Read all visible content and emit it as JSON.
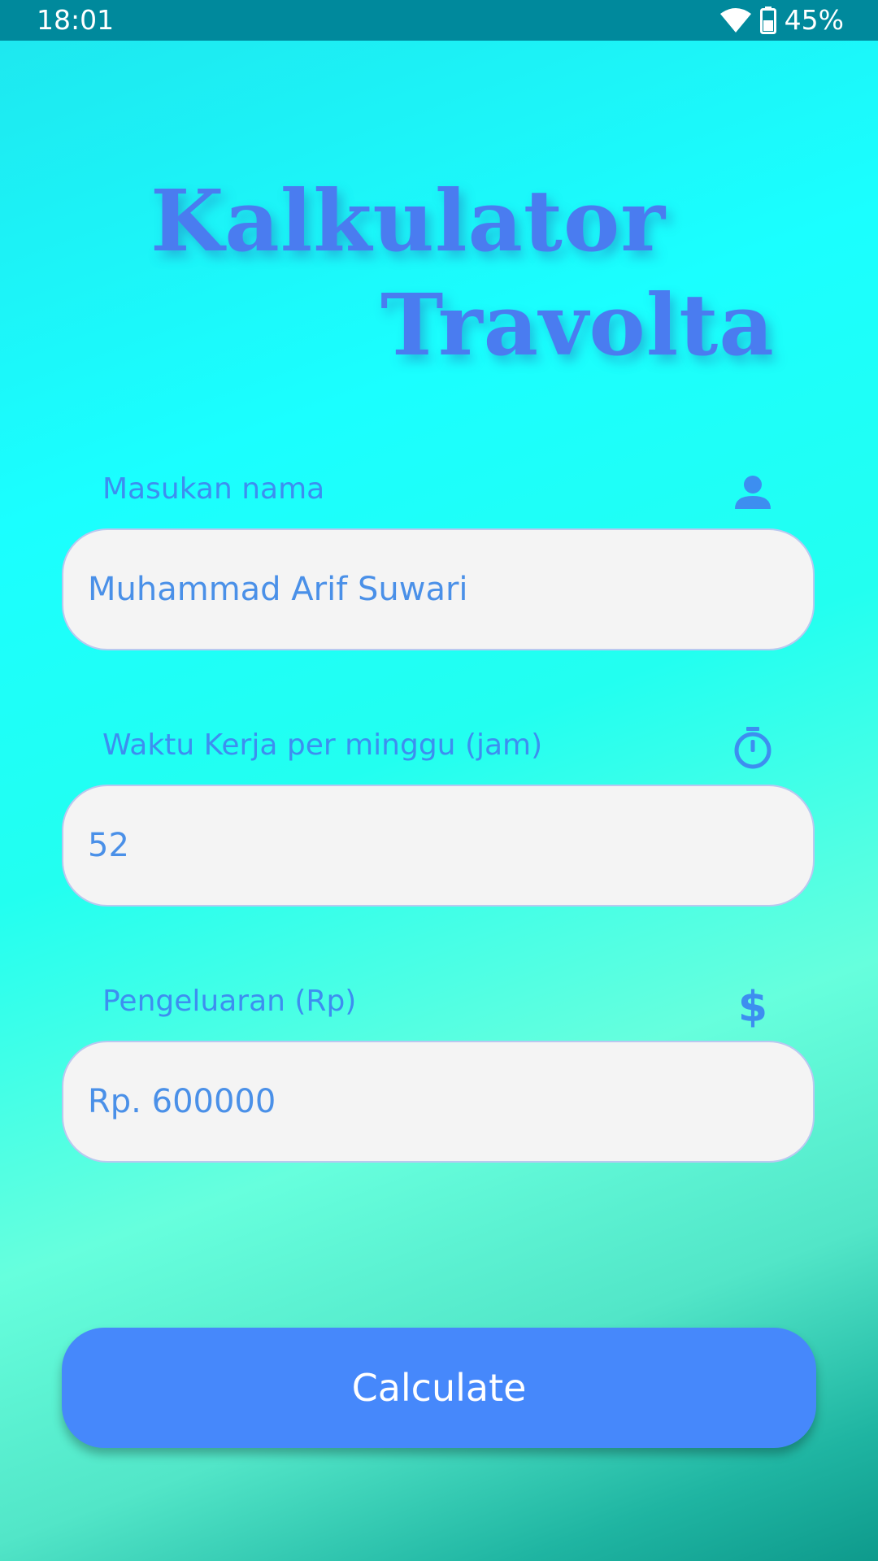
{
  "status_bar": {
    "time": "18:01",
    "battery": "45%",
    "icons": [
      "wifi-icon",
      "battery-icon"
    ]
  },
  "title": {
    "line1": "Kalkulator",
    "line2": "Travolta"
  },
  "form": {
    "name": {
      "label": "Masukan nama",
      "icon": "person-icon",
      "value": "Muhammad Arif Suwari"
    },
    "hours": {
      "label": "Waktu Kerja per minggu (jam)",
      "icon": "timer-icon",
      "value": "52"
    },
    "expense": {
      "label": "Pengeluaran (Rp)",
      "icon": "dollar-icon",
      "value": "Rp. 600000"
    }
  },
  "button": {
    "label": "Calculate"
  },
  "colors": {
    "accent": "#4688fb",
    "title": "#4a7cf0",
    "label": "#3d8ef0",
    "status_bar": "#00899c"
  }
}
